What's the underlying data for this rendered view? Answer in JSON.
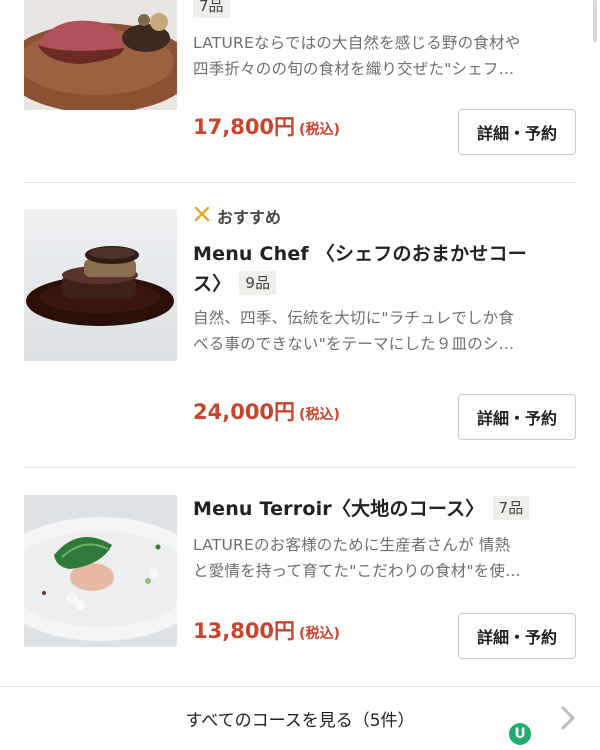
{
  "courses": [
    {
      "count": "7品",
      "desc_line1": "LATUREならではの大自然を感じる野の食材や",
      "desc_line2": "四季折々のの旬の食材を織り交ぜた\"シェフ…",
      "price": "17,800円",
      "tax": "(税込)",
      "button": "詳細・予約"
    },
    {
      "recommend": "おすすめ",
      "title_line1": "Menu Chef 〈シェフのおまかせコー",
      "title_line2": "ス〉",
      "count": "9品",
      "desc_line1": "自然、四季、伝統を大切に\"ラチュレでしか食",
      "desc_line2": "べる事のできない\"をテーマにした９皿のシ…",
      "price": "24,000円",
      "tax": "(税込)",
      "button": "詳細・予約"
    },
    {
      "title_line1": "Menu Terroir〈大地のコース〉",
      "count": "7品",
      "desc_line1": "LATUREのお客様のために生産者さんが 情熱",
      "desc_line2": "と愛情を持って育てた\"こだわりの食材\"を使…",
      "price": "13,800円",
      "tax": "(税込)",
      "button": "詳細・予約"
    }
  ],
  "footer": {
    "label": "すべてのコースを見る（5件）"
  },
  "colors": {
    "price": "#c8452c",
    "accent": "#e3a72f",
    "badge_bg": "#f1efea"
  }
}
